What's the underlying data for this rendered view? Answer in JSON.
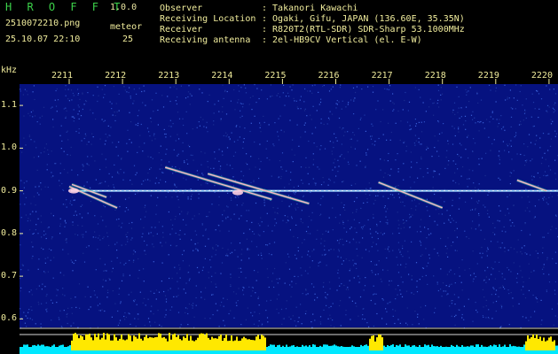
{
  "header": {
    "app_title": "H R O F F T",
    "app_version": "1.0.0",
    "filename": "2510072210.png",
    "datetime": "25.10.07 22:10",
    "meteor_label": "meteor",
    "meteor_count": "25",
    "info": [
      {
        "label": "Observer",
        "value": ": Takanori Kawachi"
      },
      {
        "label": "Receiving Location",
        "value": ": Ogaki, Gifu, JAPAN (136.60E, 35.35N)"
      },
      {
        "label": "Receiver",
        "value": ": R820T2(RTL-SDR) SDR-Sharp 53.1000MHz"
      },
      {
        "label": "Receiving antenna",
        "value": ": 2el-HB9CV Vertical (el. E-W)"
      }
    ]
  },
  "chart_data": {
    "type": "heatmap",
    "ylabel": "kHz",
    "y_ticks": [
      "1.1",
      "1.0",
      "0.9",
      "0.8",
      "0.7",
      "0.6"
    ],
    "x_ticks": [
      "2211",
      "2212",
      "2213",
      "2214",
      "2215",
      "2216",
      "2217",
      "2218",
      "2219",
      "2220"
    ],
    "ylim": [
      0.58,
      1.15
    ],
    "carrier_khz": 0.9,
    "colors": {
      "background": "#061280",
      "noise": "#1f3aa8",
      "carrier": "#9ed8ff",
      "meteor": "#ffb0c8",
      "axis_text": "#f0ec9c",
      "level_bar": "#00e8ff",
      "level_peak": "#ffe800"
    },
    "meteors": [
      {
        "t_start": 2211.0,
        "t_end": 2211.9,
        "f_start": 0.91,
        "f_end": 0.86
      },
      {
        "t_start": 2211.05,
        "t_end": 2211.7,
        "f_start": 0.915,
        "f_end": 0.885
      },
      {
        "t_start": 2212.8,
        "t_end": 2214.8,
        "f_start": 0.955,
        "f_end": 0.88
      },
      {
        "t_start": 2213.6,
        "t_end": 2215.5,
        "f_start": 0.94,
        "f_end": 0.87
      },
      {
        "t_start": 2216.8,
        "t_end": 2218.0,
        "f_start": 0.92,
        "f_end": 0.86
      },
      {
        "t_start": 2219.4,
        "t_end": 2219.95,
        "f_start": 0.925,
        "f_end": 0.9
      }
    ]
  }
}
